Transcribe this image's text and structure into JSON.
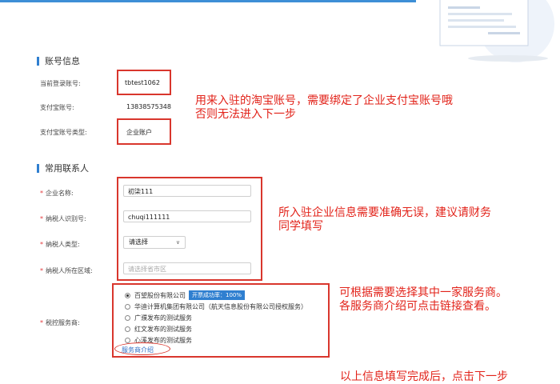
{
  "account_section": {
    "title": "账号信息",
    "login_label": "当前登录账号:",
    "login_value": "tbtest1062",
    "alipay_label": "支付宝账号:",
    "alipay_value": "13838575348",
    "alipay_type_label": "支付宝账号类型:",
    "alipay_type_value": "企业账户"
  },
  "annotation_1": {
    "line1": "用来入驻的淘宝账号，需要绑定了企业支付宝账号哦",
    "line2": "否则无法进入下一步"
  },
  "contact_section": {
    "title": "常用联系人",
    "company_label": "企业名称:",
    "company_value": "初柒111",
    "taxid_label": "纳税人识别号:",
    "taxid_value": "chuqi111111",
    "taxtype_label": "纳税人类型:",
    "taxtype_value": "请选择",
    "region_label": "纳税人所在区域:",
    "region_placeholder": "请选择省市区",
    "provider_label": "税控服务商:"
  },
  "annotation_2": {
    "line1": "所入驻企业信息需要准确无误，建议请财务",
    "line2": "同学填写"
  },
  "providers": [
    {
      "name": "百望股份有限公司",
      "badge": "开票成功率：100%",
      "selected": true
    },
    {
      "name": "华迪计算机集团有限公司（航天信息股份有限公司授权服务）",
      "badge": "",
      "selected": false
    },
    {
      "name": "广濮发布的测试服务",
      "badge": "",
      "selected": false
    },
    {
      "name": "红文发布的测试服务",
      "badge": "",
      "selected": false
    },
    {
      "name": "心溪发布的测试服务",
      "badge": "",
      "selected": false
    }
  ],
  "provider_link": "服务商介绍",
  "annotation_3": {
    "line1": "可根据需要选择其中一家服务商。",
    "line2": "各服务商介绍可点击链接查看。"
  },
  "bottom_note": "以上信息填写完成后，点击下一步",
  "colors": {
    "accent": "#2f7fd0",
    "annotation_red": "#e2231a",
    "required": "#e4393c"
  }
}
